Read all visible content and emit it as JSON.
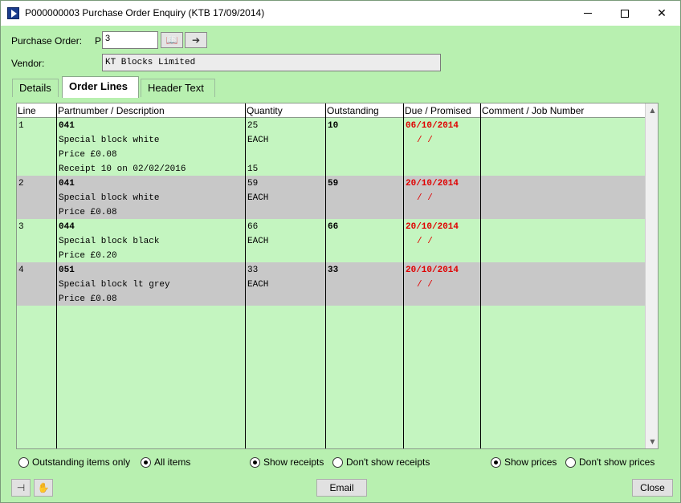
{
  "window": {
    "title": "P000000003 Purchase Order Enquiry (KTB 17/09/2014)"
  },
  "header": {
    "po_label": "Purchase Order:",
    "po_prefix": "P",
    "po_value": "3",
    "vendor_label": "Vendor:",
    "vendor_value": "KT Blocks Limited"
  },
  "tabs": [
    {
      "label": "Details",
      "active": false
    },
    {
      "label": "Order Lines",
      "active": true
    },
    {
      "label": "Header Text",
      "active": false
    }
  ],
  "grid": {
    "columns": [
      "Line",
      "Partnumber / Description",
      "Quantity",
      "Outstanding",
      "Due / Promised",
      "Comment / Job Number"
    ],
    "rows": [
      {
        "line": "1",
        "part": "041",
        "desc": "Special block white",
        "price": "Price £0.08",
        "receipt": "Receipt 10 on 02/02/2016",
        "receipt_qty": "15",
        "qty": "25",
        "uom": "EACH",
        "outstanding": "10",
        "due": "06/10/2014",
        "promised": "/  /"
      },
      {
        "line": "2",
        "part": "041",
        "desc": "Special block white",
        "price": "Price £0.08",
        "qty": "59",
        "uom": "EACH",
        "outstanding": "59",
        "due": "20/10/2014",
        "promised": "/  /"
      },
      {
        "line": "3",
        "part": "044",
        "desc": "Special block black",
        "price": "Price £0.20",
        "qty": "66",
        "uom": "EACH",
        "outstanding": "66",
        "due": "20/10/2014",
        "promised": "/  /"
      },
      {
        "line": "4",
        "part": "051",
        "desc": "Special block lt grey",
        "price": "Price £0.08",
        "qty": "33",
        "uom": "EACH",
        "outstanding": "33",
        "due": "20/10/2014",
        "promised": "/  /"
      }
    ]
  },
  "filters": {
    "outstanding_only": "Outstanding items only",
    "all_items": "All items",
    "show_receipts": "Show receipts",
    "dont_show_receipts": "Don't show receipts",
    "show_prices": "Show prices",
    "dont_show_prices": "Don't show prices"
  },
  "footer": {
    "email_label": "Email",
    "close_label": "Close"
  },
  "colors": {
    "window_bg": "#b8f0b0",
    "grid_bg": "#c4f5c0",
    "row_alt": "#c8c8c8",
    "due_red": "#e00000"
  },
  "icons": {
    "lookup": "book-icon",
    "go": "arrow-right-icon",
    "pin": "pin-icon",
    "hand": "hand-icon"
  }
}
